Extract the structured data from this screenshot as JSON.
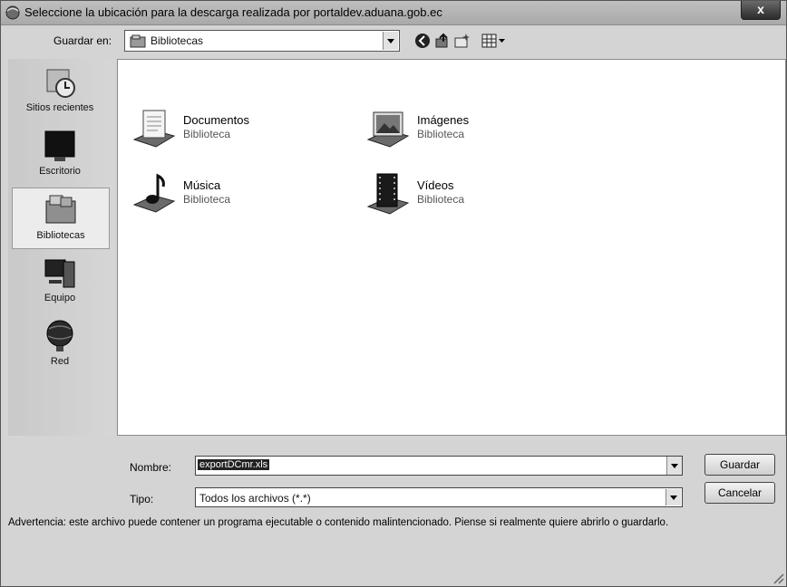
{
  "window": {
    "title": "Seleccione la ubicación para la descarga realizada por portaldev.aduana.gob.ec",
    "close_label": "x"
  },
  "toolbar": {
    "save_in_label": "Guardar en:",
    "location_value": "Bibliotecas",
    "icons": [
      "back-icon",
      "up-folder-icon",
      "new-folder-icon",
      "view-menu-icon"
    ]
  },
  "places": [
    {
      "label": "Sitios recientes",
      "icon": "recent-places-icon"
    },
    {
      "label": "Escritorio",
      "icon": "desktop-icon"
    },
    {
      "label": "Bibliotecas",
      "icon": "libraries-icon"
    },
    {
      "label": "Equipo",
      "icon": "computer-icon"
    },
    {
      "label": "Red",
      "icon": "network-icon"
    }
  ],
  "files": [
    {
      "name": "Documentos",
      "type": "Biblioteca",
      "icon": "documents-library-icon"
    },
    {
      "name": "Imágenes",
      "type": "Biblioteca",
      "icon": "pictures-library-icon"
    },
    {
      "name": "Música",
      "type": "Biblioteca",
      "icon": "music-library-icon"
    },
    {
      "name": "Vídeos",
      "type": "Biblioteca",
      "icon": "videos-library-icon"
    }
  ],
  "form": {
    "name_label": "Nombre:",
    "name_value": "exportDCmr.xls",
    "type_label": "Tipo:",
    "type_value": "Todos los archivos (*.*)",
    "save_button": "Guardar",
    "cancel_button": "Cancelar"
  },
  "warning": "Advertencia: este archivo puede contener un programa ejecutable o contenido malintencionado. Piense si realmente quiere abrirlo o guardarlo."
}
